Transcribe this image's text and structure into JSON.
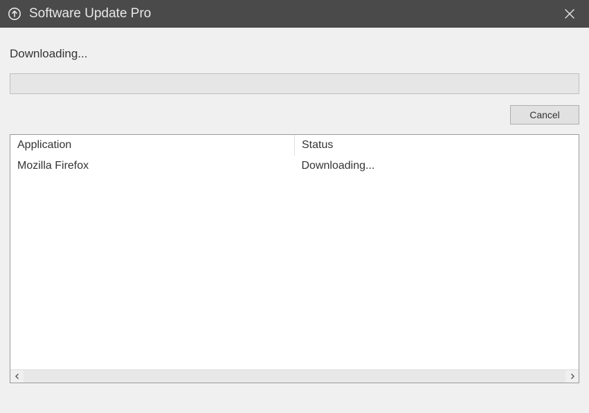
{
  "window": {
    "title": "Software Update Pro"
  },
  "main": {
    "status_text": "Downloading...",
    "progress_percent": 0
  },
  "buttons": {
    "cancel": "Cancel"
  },
  "table": {
    "columns": {
      "application": "Application",
      "status": "Status"
    },
    "rows": [
      {
        "application": "Mozilla Firefox",
        "status": "Downloading..."
      }
    ]
  }
}
